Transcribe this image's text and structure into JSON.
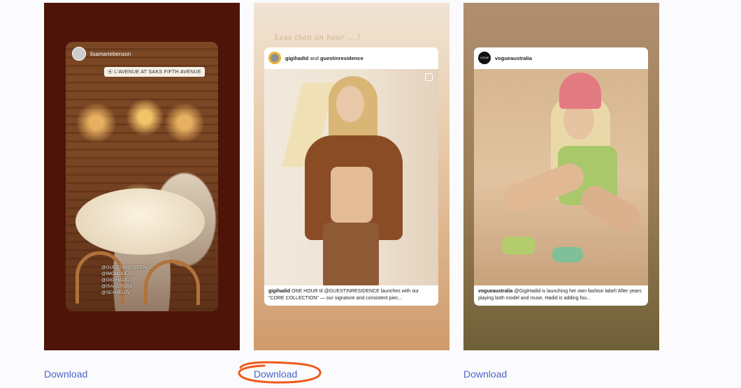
{
  "stories": [
    {
      "username": "lisamariebenson",
      "location_tag": "L'AVENUE AT SAKS FIFTH AVENUE",
      "mentions": [
        "@GUESTINRESIDENCE",
        "@IMGMODELS",
        "@GIGIHADID",
        "@ISAACROSS",
        "@SEANELUV"
      ]
    },
    {
      "script_text": "Less than an hour ... !",
      "post": {
        "user": "gigihadid",
        "joiner": "and",
        "collab": "guestinresidence",
        "caption_user": "gigihadid",
        "caption_text": "ONE HOUR til @GUESTINRESIDENCE launches with our \"CORE COLLECTION\" — our signature and consistent piec..."
      }
    },
    {
      "post": {
        "user": "vogueaustralia",
        "avatar_text": "VOGUE",
        "caption_user": "vogueaustralia",
        "caption_text": "@GigiHadid is launching her own fashion label! After years playing both model and muse, Hadid is adding fou..."
      }
    }
  ],
  "downloads": [
    "Download",
    "Download",
    "Download"
  ],
  "annotation": {
    "color": "#f05a1a"
  },
  "colors": {
    "link": "#4a63c8",
    "page_bg": "#fbfbfd"
  }
}
